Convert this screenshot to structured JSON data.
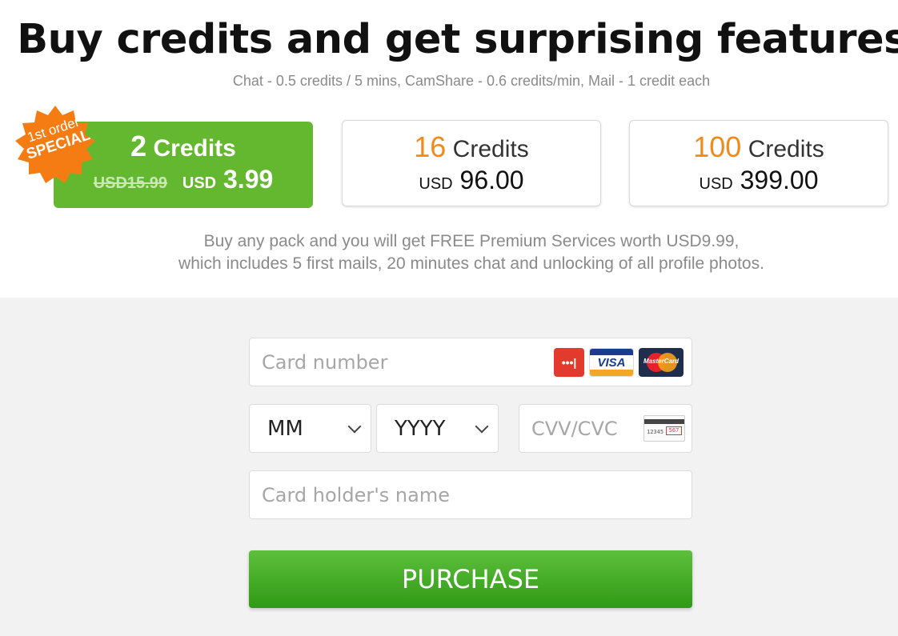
{
  "header": {
    "title": "Buy credits and get surprising features!",
    "subtitle": "Chat - 0.5 credits / 5 mins, CamShare - 0.6 credits/min, Mail - 1 credit each"
  },
  "badge": {
    "line1": "1st order",
    "line2": "SPECIAL"
  },
  "packs": [
    {
      "amount": "2",
      "unit": "Credits",
      "old_price": "USD15.99",
      "currency": "USD",
      "price": "3.99"
    },
    {
      "amount": "16",
      "unit": "Credits",
      "currency": "USD",
      "price": "96.00"
    },
    {
      "amount": "100",
      "unit": "Credits",
      "currency": "USD",
      "price": "399.00"
    }
  ],
  "info": {
    "line1": "Buy any pack and you will get FREE Premium Services worth USD9.99,",
    "line2": "which includes 5 first mails, 20 minutes chat and unlocking of all profile photos."
  },
  "form": {
    "card_number_placeholder": "Card number",
    "month_selected": "MM",
    "year_selected": "YYYY",
    "cvv_placeholder": "CVV/CVC",
    "holder_placeholder": "Card holder's name",
    "purchase_label": "PURCHASE",
    "card_icons": [
      "card-generic-icon",
      "visa-icon",
      "mastercard-icon"
    ],
    "visa_text": "VISA",
    "mastercard_text": "MasterCard",
    "cvv_digits": "12345",
    "cvv_code": "567"
  },
  "colors": {
    "green": "#64b82f",
    "orange": "#f28a1b",
    "purchase": "#3aa81e"
  }
}
